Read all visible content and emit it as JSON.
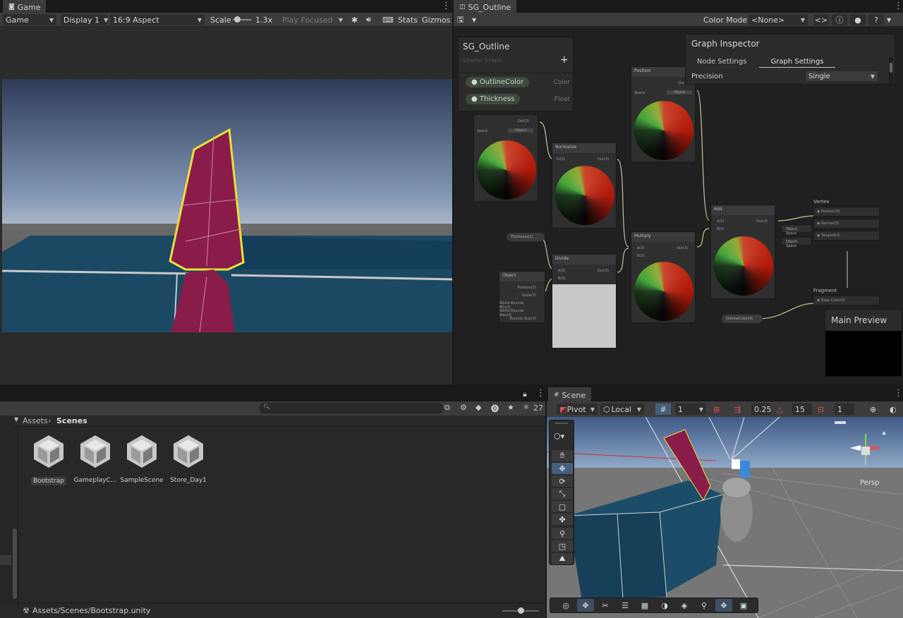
{
  "game": {
    "tab_label": "Game",
    "mode_dropdown": "Game",
    "display_dropdown": "Display 1",
    "aspect_dropdown": "16:9 Aspect",
    "scale_label": "Scale",
    "scale_value": "1.3x",
    "play_mode_dropdown": "Play Focused",
    "stats_label": "Stats",
    "gizmos_label": "Gizmos"
  },
  "shadergraph": {
    "tab_label": "SG_Outline",
    "color_mode_label": "Color Mode",
    "color_mode_value": "<None>",
    "blackboard": {
      "title": "SG_Outline",
      "subtitle": "Shader Graph",
      "properties": [
        {
          "name": "OutlineColor",
          "type": "Color"
        },
        {
          "name": "Thickness",
          "type": "Float"
        }
      ]
    },
    "inspector": {
      "title": "Graph Inspector",
      "tabs": [
        "Node Settings",
        "Graph Settings"
      ],
      "active_tab": "Graph Settings",
      "precision_label": "Precision",
      "precision_value": "Single"
    },
    "nodes": {
      "position_top_title": "Position",
      "position_top_out": "Out",
      "position_left_out": "Out(3)",
      "space_label": "Space",
      "space_value": "Object",
      "normalize_title": "Normalize",
      "normalize_in": "In(3)",
      "normalize_out": "Out(3)",
      "thickness_pill": "Thickness(1)",
      "object_title": "Object",
      "object_ports": [
        "Position(3)",
        "Scale(3)",
        "World Bounds Min(3)",
        "World Bounds Max(3)",
        "Bounds Size(3)"
      ],
      "divide_title": "Divide",
      "divide_a": "A(3)",
      "divide_b": "B(3)",
      "divide_out": "Out(3)",
      "multiply_title": "Multiply",
      "multiply_a": "A(3)",
      "multiply_b": "B(3)",
      "multiply_out": "Out(3)",
      "add_title": "Add",
      "add_a": "A(3)",
      "add_b": "B(3)",
      "add_out": "Out(3)",
      "vertex_title": "Vertex",
      "vertex_ports": [
        "Position(3)",
        "Normal(3)",
        "Tangent(3)"
      ],
      "object_space_pill_1": "Object Space",
      "object_space_pill_2": "Object Space",
      "fragment_title": "Fragment",
      "fragment_port": "Base Color(3)",
      "outline_color_pill": "OutlineColor(4)"
    },
    "main_preview_title": "Main Preview"
  },
  "project": {
    "breadcrumb_root": "Assets",
    "breadcrumb_current": "Scenes",
    "hidden_count": "27",
    "assets": [
      "Bootstrap",
      "GameplayC...",
      "SampleScene",
      "Store_Day1"
    ],
    "selected_asset": "Bootstrap",
    "status_path": "Assets/Scenes/Bootstrap.unity"
  },
  "scene": {
    "tab_label": "Scene",
    "pivot_label": "Pivot",
    "local_label": "Local",
    "grid_value": "1",
    "snap_value": "0.25",
    "angle_value": "15",
    "scale_snap_value": "1",
    "persp_label": "Persp"
  },
  "colors": {
    "accent_blue": "#46607c",
    "outline_yellow": "#e8e23a",
    "pillar_magenta": "#8a1c4a",
    "floor_teal": "#1c4d68"
  }
}
